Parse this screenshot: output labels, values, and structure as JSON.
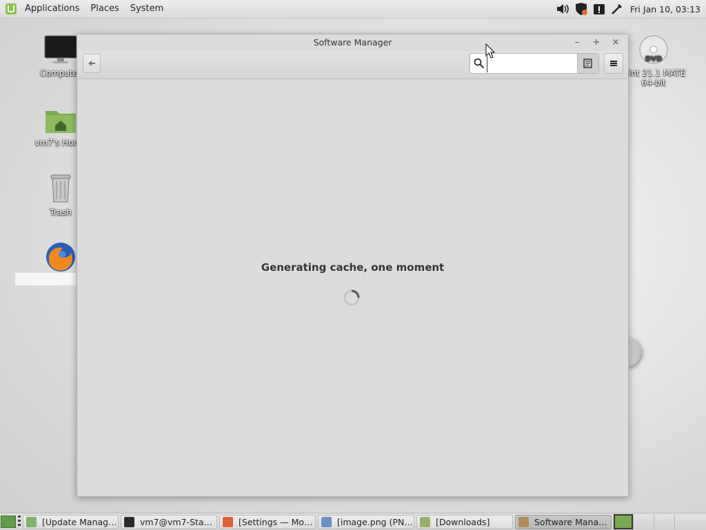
{
  "top_panel": {
    "menus": [
      "Applications",
      "Places",
      "System"
    ],
    "clock": "Fri Jan 10, 03:13"
  },
  "desktop": {
    "icons": [
      {
        "label": "Computer",
        "icon": "monitor-icon"
      },
      {
        "label": "vm7's Home",
        "icon": "home-folder-icon"
      },
      {
        "label": "Trash",
        "icon": "trash-icon"
      },
      {
        "label": "",
        "icon": "firefox-icon"
      },
      {
        "label": "Mint 21.1 MATE 64-bit",
        "icon": "dvd-icon"
      }
    ]
  },
  "window": {
    "title": "Software Manager",
    "controls": {
      "minimize": "–",
      "maximize": "+",
      "close": "×"
    },
    "search": {
      "value": "",
      "placeholder": ""
    },
    "loading_text": "Generating cache, one moment"
  },
  "taskbar": {
    "tasks": [
      {
        "label": "[Update Manag…",
        "icon": "update-manager-icon",
        "color": "#7fb36a"
      },
      {
        "label": "vm7@vm7-Sta…",
        "icon": "terminal-icon",
        "color": "#2b2b2b"
      },
      {
        "label": "[Settings — Mo…",
        "icon": "settings-icon",
        "color": "#e0603a"
      },
      {
        "label": "[image.png (PN…",
        "icon": "image-viewer-icon",
        "color": "#6a8fc4"
      },
      {
        "label": "[Downloads]",
        "icon": "folder-icon",
        "color": "#9ab06a"
      },
      {
        "label": "Software Mana…",
        "icon": "software-manager-icon",
        "color": "#b08a5a",
        "active": true
      }
    ]
  }
}
